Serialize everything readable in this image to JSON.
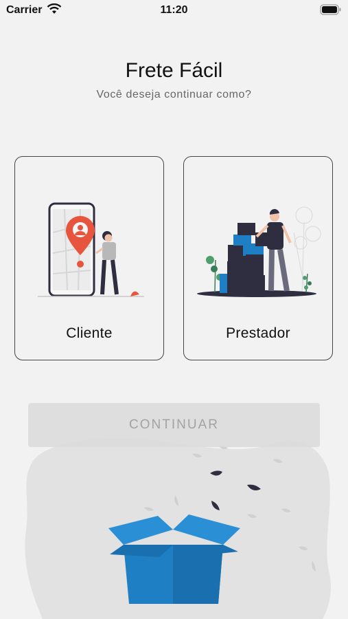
{
  "status_bar": {
    "carrier": "Carrier",
    "time": "11:20"
  },
  "header": {
    "title": "Frete Fácil",
    "subtitle": "Você deseja continuar como?"
  },
  "options": [
    {
      "label": "Cliente"
    },
    {
      "label": "Prestador"
    }
  ],
  "continue_button": {
    "label": "CONTINUAR",
    "enabled": false
  },
  "colors": {
    "background": "#f2f2f2",
    "accent_red": "#e8553e",
    "box_blue": "#1f7fc4",
    "dark_figure": "#2f2e41"
  },
  "icons": [
    "wifi-icon",
    "battery-icon",
    "map-pin-icon",
    "box-icon"
  ]
}
